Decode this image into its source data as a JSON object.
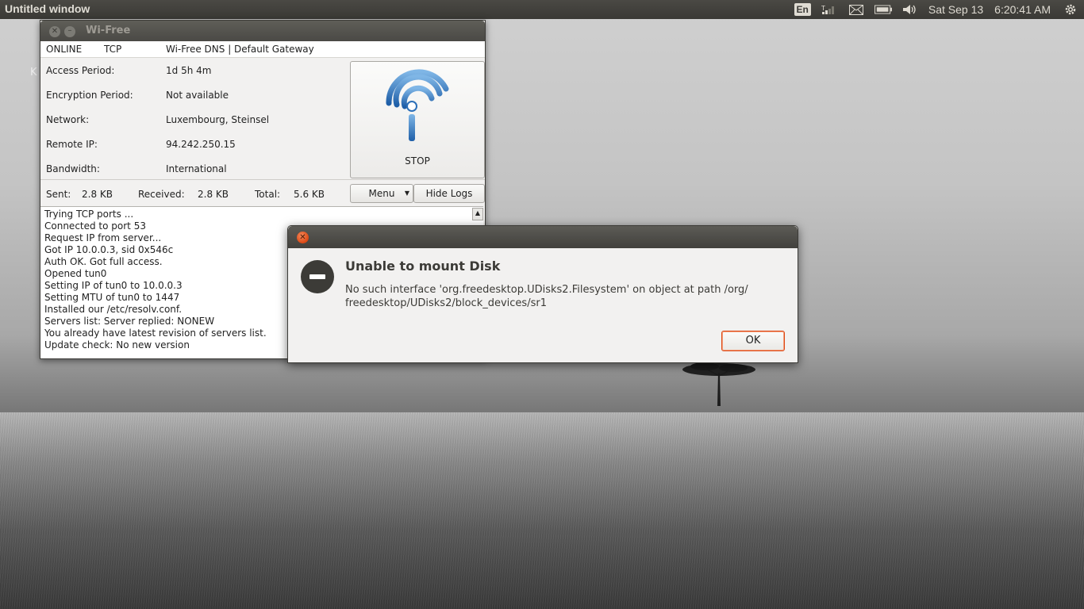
{
  "panel": {
    "title": "Untitled window",
    "lang": "En",
    "date": "Sat Sep 13",
    "time": "6:20:41 AM",
    "tray_icons": [
      "network-icon",
      "mail-icon",
      "battery-icon",
      "volume-icon",
      "gear-icon"
    ]
  },
  "desktop": {
    "stray_letter": "K"
  },
  "wifree": {
    "title": "Wi-Free",
    "status": {
      "state": "ONLINE",
      "protocol": "TCP",
      "dns": "Wi-Free DNS | Default Gateway"
    },
    "info": [
      {
        "label": "Access Period:",
        "value": "1d 5h 4m"
      },
      {
        "label": "Encryption Period:",
        "value": "Not available"
      },
      {
        "label": "Network:",
        "value": "Luxembourg, Steinsel"
      },
      {
        "label": "Remote IP:",
        "value": "94.242.250.15"
      },
      {
        "label": "Bandwidth:",
        "value": "International"
      }
    ],
    "stop_label": "STOP",
    "counters": {
      "sent_label": "Sent:",
      "sent": "2.8 KB",
      "received_label": "Received:",
      "received": "2.8 KB",
      "total_label": "Total:",
      "total": "5.6 KB"
    },
    "menu_label": "Menu",
    "hide_logs_label": "Hide Logs",
    "logs": [
      "Trying TCP ports ...",
      "Connected to port 53",
      "Request IP from server...",
      "Got IP 10.0.0.3, sid 0x546c",
      "Auth OK. Got full access.",
      "Opened tun0",
      "Setting IP of tun0 to 10.0.0.3",
      "Setting MTU of tun0 to 1447",
      "Installed our /etc/resolv.conf.",
      "Servers list: Server replied: NONEW",
      "You already have latest revision of servers list.",
      "Update check: No new version"
    ]
  },
  "dialog": {
    "heading": "Unable to mount Disk",
    "message_line1": "No such interface 'org.freedesktop.UDisks2.Filesystem' on object at path /org/",
    "message_line2": "freedesktop/UDisks2/block_devices/sr1",
    "ok_label": "OK"
  },
  "colors": {
    "accent": "#dd4814",
    "panel_bg": "#3c3b37",
    "window_bg": "#f2f1f0"
  }
}
